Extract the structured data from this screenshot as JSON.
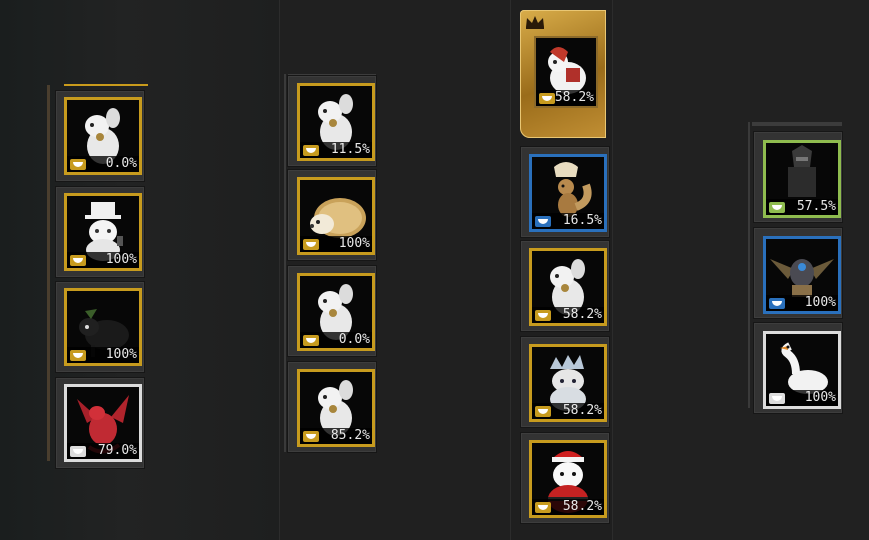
{
  "colors": {
    "gold": "#c79b1e",
    "blue": "#2a70bc",
    "green": "#8fbc4f",
    "white": "#dcdcdc"
  },
  "columns": [
    {
      "pets": [
        {
          "name": "white-fluffy-dog-bell",
          "percent": "0.0%",
          "frame": "gold"
        },
        {
          "name": "white-cat-top-hat",
          "percent": "100%",
          "frame": "gold"
        },
        {
          "name": "black-cat-bow",
          "percent": "100%",
          "frame": "gold"
        },
        {
          "name": "red-dragon",
          "percent": "79.0%",
          "frame": "white"
        }
      ]
    },
    {
      "pets": [
        {
          "name": "white-fluffy-dog-bell",
          "percent": "11.5%",
          "frame": "gold"
        },
        {
          "name": "hedgehog",
          "percent": "100%",
          "frame": "gold"
        },
        {
          "name": "white-fluffy-dog-bell",
          "percent": "0.0%",
          "frame": "gold"
        },
        {
          "name": "white-fluffy-dog-bell",
          "percent": "85.2%",
          "frame": "gold"
        }
      ]
    },
    {
      "featured": {
        "name": "white-wolf-red-scarf",
        "percent": "58.2%",
        "badge": "crown-icon"
      },
      "pets": [
        {
          "name": "eggshell-squirrel",
          "percent": "16.5%",
          "frame": "blue"
        },
        {
          "name": "white-fluffy-dog-bell",
          "percent": "58.2%",
          "frame": "gold"
        },
        {
          "name": "blue-helmet-cat",
          "percent": "58.2%",
          "frame": "gold"
        },
        {
          "name": "polar-bear-santa-hat",
          "percent": "58.2%",
          "frame": "gold"
        }
      ]
    },
    {
      "pets": [
        {
          "name": "dark-armored-knight",
          "percent": "57.5%",
          "frame": "green"
        },
        {
          "name": "winged-mecha-beast",
          "percent": "100%",
          "frame": "blue"
        },
        {
          "name": "white-goose",
          "percent": "100%",
          "frame": "white"
        }
      ]
    }
  ]
}
